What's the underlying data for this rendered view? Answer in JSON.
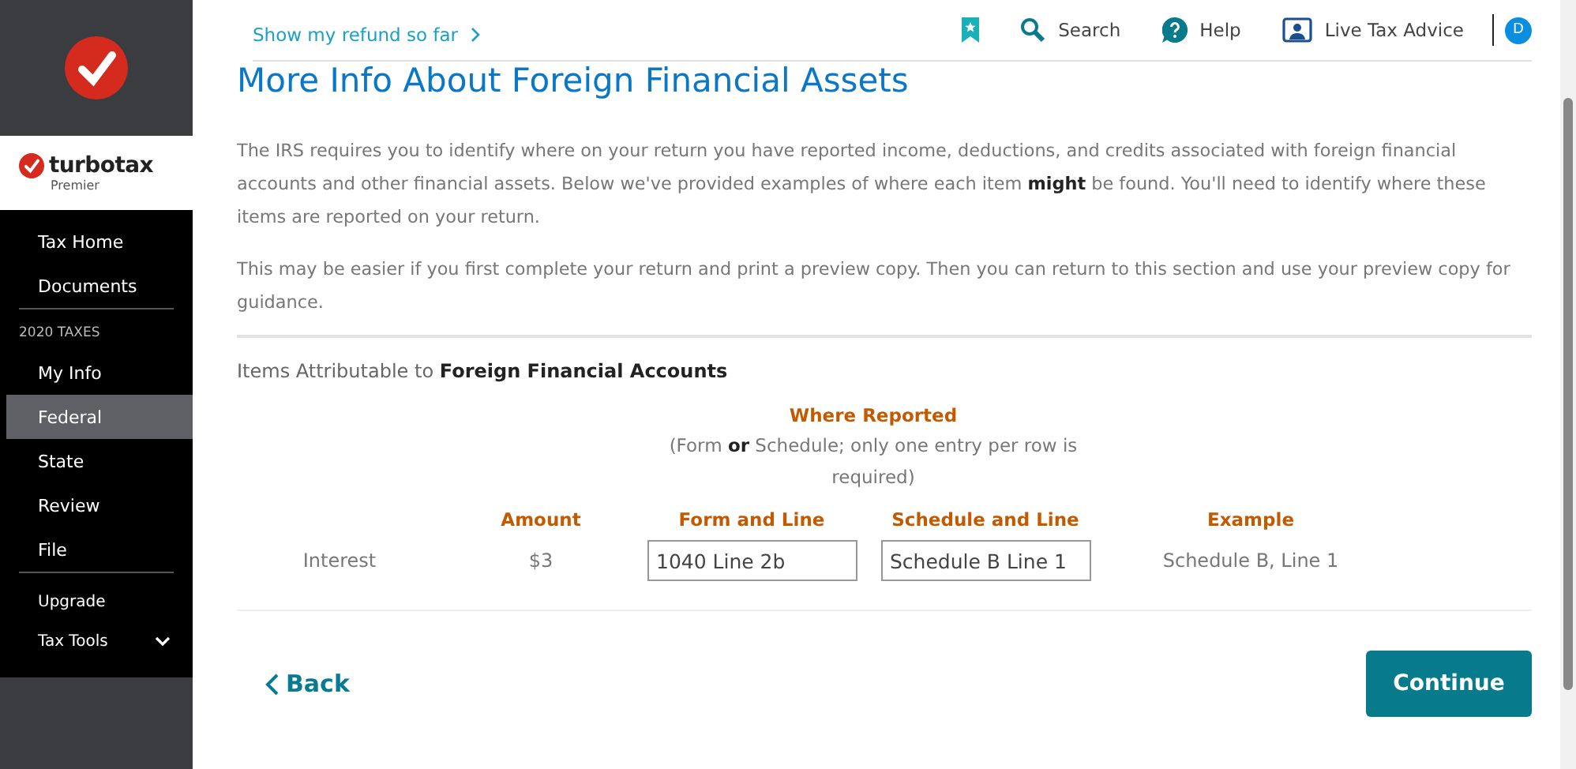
{
  "sidebar": {
    "brand": {
      "name": "turbotax",
      "edition": "Premier"
    },
    "sections": [
      {
        "items": [
          {
            "label": "Tax Home",
            "selected": false
          },
          {
            "label": "Documents",
            "selected": false
          }
        ]
      },
      {
        "heading": "2020 TAXES",
        "items": [
          {
            "label": "My Info",
            "selected": false
          },
          {
            "label": "Federal",
            "selected": true
          },
          {
            "label": "State",
            "selected": false
          },
          {
            "label": "Review",
            "selected": false
          },
          {
            "label": "File",
            "selected": false
          }
        ]
      },
      {
        "items": [
          {
            "label": "Upgrade",
            "selected": false
          },
          {
            "label": "Tax Tools",
            "selected": false,
            "expandable": true
          }
        ]
      }
    ]
  },
  "top_bar": {
    "refund_link": "Show my refund so far",
    "search": "Search",
    "help": "Help",
    "live_advice": "Live Tax Advice",
    "avatar": "D"
  },
  "title": "More Info About Foreign Financial Assets",
  "paragraphs": [
    "The IRS requires you to identify where on your return you have reported income, deductions, and credits associated with foreign financial accounts and other financial assets. Below we've provided examples of where each item **might** be found. You'll need to identify where these items are reported on your return.",
    "This may be easier if you first complete your return and print a preview copy. Then you can return to this section and use your preview copy for guidance."
  ],
  "section_heading": "Items Attributable to **Foreign Financial Accounts**",
  "table": {
    "group_heading": "Where Reported",
    "group_note": "(Form **or** Schedule; only one entry per row is required)",
    "columns": [
      "Amount",
      "Form and Line",
      "Schedule and Line",
      "Example"
    ],
    "rows": [
      {
        "label": "Interest",
        "amount": "$3",
        "form_line": "1040 Line 2b",
        "schedule_line": "Schedule B Line 1",
        "example": "Schedule B, Line 1"
      }
    ]
  },
  "buttons": {
    "back": "Back",
    "continue": "Continue"
  }
}
